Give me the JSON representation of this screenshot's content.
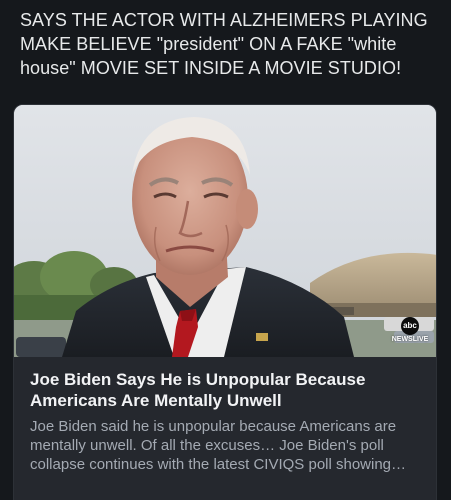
{
  "post": {
    "text": "SAYS THE ACTOR WITH ALZHEIMERS PLAYING MAKE BELIEVE \"president\" ON A FAKE \"white house\" MOVIE SET INSIDE A MOVIE STUDIO!"
  },
  "link_card": {
    "title": "Joe Biden Says He is Unpopular Because Americans Are Mentally Unwell",
    "description": "Joe Biden said he is unpopular because Americans are mentally unwell. Of all the excuses… Joe Biden's poll collapse continues with the latest CIVIQS poll showing…",
    "image": {
      "subject": "man in dark suit, white shirt and red tie, outdoors near hangar",
      "network_logo": "abc",
      "network_label": "NEWSLIVE"
    }
  },
  "colors": {
    "background": "#15181c",
    "card_background": "#25282e",
    "text_primary": "#e7e9ea",
    "text_secondary": "#a4aab3"
  }
}
